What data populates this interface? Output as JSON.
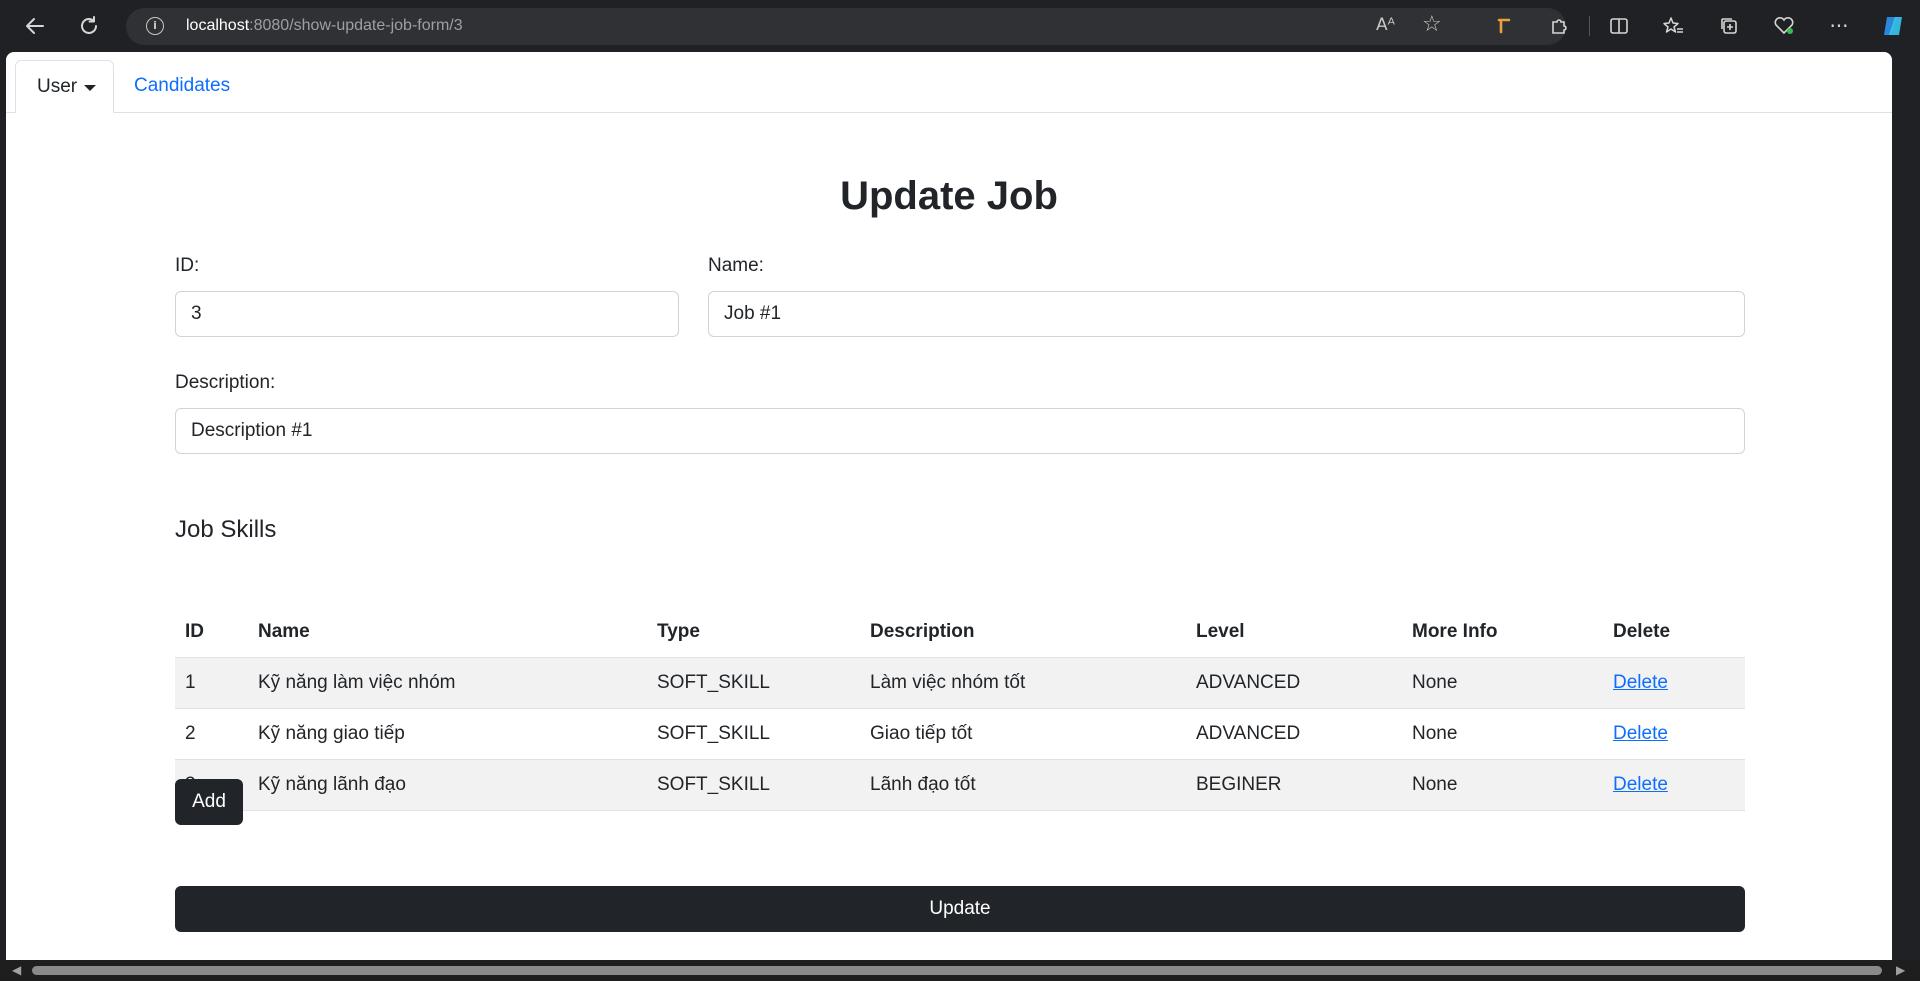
{
  "browser": {
    "url_host": "localhost",
    "url_path": ":8080/show-update-job-form/3",
    "read_aloud": "Aᴬ"
  },
  "nav": {
    "user_label": "User",
    "candidates_label": "Candidates"
  },
  "form": {
    "title": "Update Job",
    "id_label": "ID:",
    "id_value": "3",
    "name_label": "Name:",
    "name_value": "Job #1",
    "description_label": "Description:",
    "description_value": "Description #1"
  },
  "skills": {
    "heading": "Job Skills",
    "columns": [
      "ID",
      "Name",
      "Type",
      "Description",
      "Level",
      "More Info",
      "Delete"
    ],
    "rows": [
      {
        "id": "1",
        "name": "Kỹ năng làm việc nhóm",
        "type": "SOFT_SKILL",
        "description": "Làm việc nhóm tốt",
        "level": "ADVANCED",
        "more_info": "None",
        "delete": "Delete"
      },
      {
        "id": "2",
        "name": "Kỹ năng giao tiếp",
        "type": "SOFT_SKILL",
        "description": "Giao tiếp tốt",
        "level": "ADVANCED",
        "more_info": "None",
        "delete": "Delete"
      },
      {
        "id": "3",
        "name": "Kỹ năng lãnh đạo",
        "type": "SOFT_SKILL",
        "description": "Lãnh đạo tốt",
        "level": "BEGINER",
        "more_info": "None",
        "delete": "Delete"
      }
    ],
    "add_label": "Add"
  },
  "update_label": "Update",
  "colors": {
    "primary_link": "#0d6efd",
    "dark_button": "#212529",
    "striped_row": "#f2f2f2"
  }
}
